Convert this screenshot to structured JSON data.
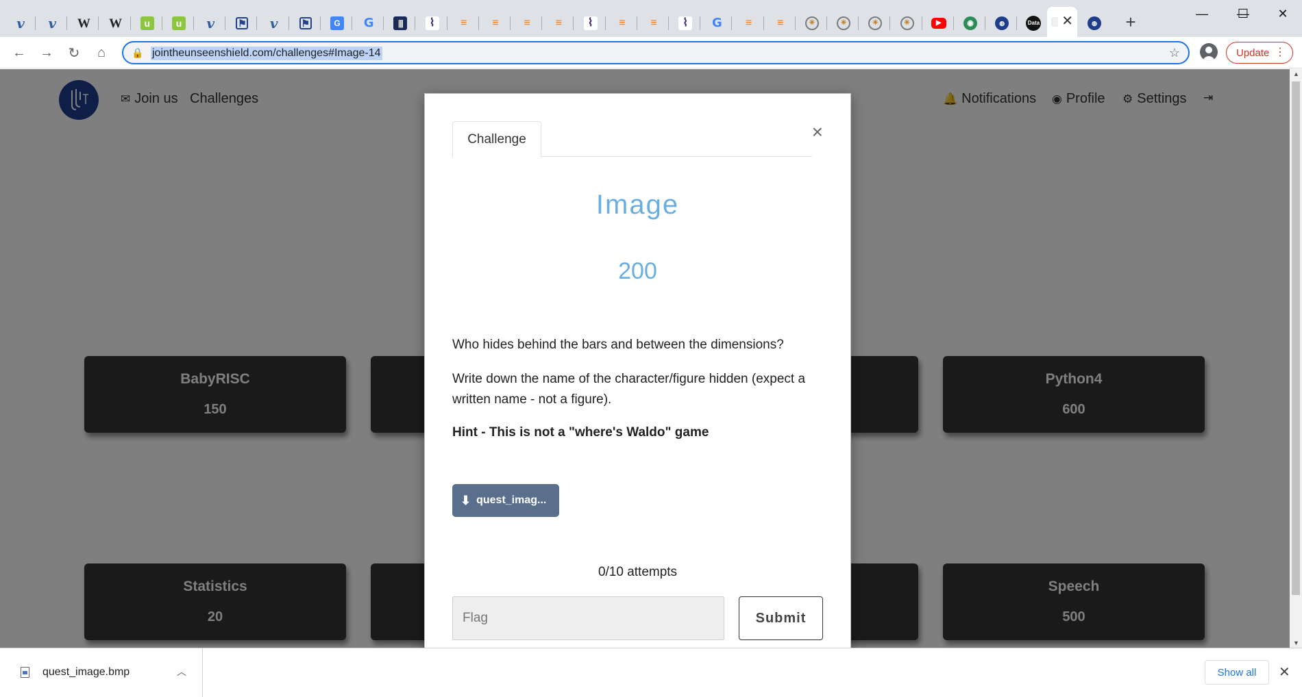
{
  "browser": {
    "tabs": [
      {
        "icon": "v-icon",
        "glyph": "v"
      },
      {
        "icon": "v-icon",
        "glyph": "v"
      },
      {
        "icon": "wikipedia-icon",
        "glyph": "W"
      },
      {
        "icon": "wikipedia-icon",
        "glyph": "W"
      },
      {
        "icon": "u-icon",
        "glyph": "u"
      },
      {
        "icon": "u-icon",
        "glyph": "u"
      },
      {
        "icon": "v-icon",
        "glyph": "v"
      },
      {
        "icon": "emblem-icon",
        "glyph": "⚑"
      },
      {
        "icon": "v-icon",
        "glyph": "v"
      },
      {
        "icon": "emblem-icon",
        "glyph": "⚑"
      },
      {
        "icon": "translate-icon",
        "glyph": "G"
      },
      {
        "icon": "google-icon",
        "glyph": "G"
      },
      {
        "icon": "bars-icon",
        "glyph": "|||"
      },
      {
        "icon": "dna-icon",
        "glyph": "⌇"
      },
      {
        "icon": "stackoverflow-icon",
        "glyph": "≡"
      },
      {
        "icon": "stackoverflow-icon",
        "glyph": "≡"
      },
      {
        "icon": "stackoverflow-icon",
        "glyph": "≡"
      },
      {
        "icon": "stackoverflow-icon",
        "glyph": "≡"
      },
      {
        "icon": "dna-icon",
        "glyph": "⌇"
      },
      {
        "icon": "stackoverflow-icon",
        "glyph": "≡"
      },
      {
        "icon": "stackoverflow-icon",
        "glyph": "≡"
      },
      {
        "icon": "dna-icon",
        "glyph": "⌇"
      },
      {
        "icon": "google-icon",
        "glyph": "G"
      },
      {
        "icon": "stackoverflow-icon",
        "glyph": "≡"
      },
      {
        "icon": "stackoverflow-icon",
        "glyph": "≡"
      },
      {
        "icon": "ring-icon",
        "glyph": "✳"
      },
      {
        "icon": "ring-icon",
        "glyph": "✳"
      },
      {
        "icon": "ring-icon",
        "glyph": "✳"
      },
      {
        "icon": "ring-icon",
        "glyph": "✳"
      },
      {
        "icon": "youtube-icon",
        "glyph": "▶"
      },
      {
        "icon": "globe-icon",
        "glyph": "◉"
      },
      {
        "icon": "round-logo-icon",
        "glyph": "◍"
      },
      {
        "icon": "data-icon",
        "glyph": "Data"
      }
    ],
    "active_tab_close": "✕",
    "new_tab": "+",
    "window": {
      "minimize": "—",
      "maximize": "☐",
      "close": "✕"
    },
    "url": "jointheunseenshield.com/challenges#Image-14",
    "update_label": "Update"
  },
  "site": {
    "nav_left": [
      {
        "icon": "✉",
        "label": "Join us"
      },
      {
        "icon": "",
        "label": "Challenges"
      }
    ],
    "nav_right": [
      {
        "icon": "🔔",
        "label": "Notifications"
      },
      {
        "icon": "◉",
        "label": "Profile"
      },
      {
        "icon": "⚙",
        "label": "Settings"
      },
      {
        "icon": "⇥",
        "label": ""
      }
    ],
    "logo_text": "",
    "cards": [
      {
        "title": "BabyRISC",
        "value": "150"
      },
      {
        "title": "",
        "value": ""
      },
      {
        "title": "",
        "value": ""
      },
      {
        "title": "Python4",
        "value": "600"
      },
      {
        "title": "Statistics",
        "value": "20"
      },
      {
        "title": "",
        "value": ""
      },
      {
        "title": "",
        "value": ""
      },
      {
        "title": "Speech",
        "value": "500"
      }
    ]
  },
  "modal": {
    "tab_label": "Challenge",
    "close": "×",
    "name": "Image",
    "value": "200",
    "description_1": "Who hides behind the bars and between the dimensions?",
    "description_2": "Write down the name of the character/figure hidden (expect a written name - not a figure).",
    "hint": "Hint - This is not a \"where's Waldo\" game",
    "file_label": "quest_imag...",
    "attempts": "0/10 attempts",
    "flag_placeholder": "Flag",
    "submit_label": "Submit"
  },
  "downloads": {
    "file_name": "quest_image.bmp",
    "show_all": "Show all",
    "close": "✕"
  },
  "colors": {
    "accent": "#6aaee0",
    "card_bg": "#343434",
    "file_button": "#5a6f8c",
    "update": "#d93025"
  }
}
